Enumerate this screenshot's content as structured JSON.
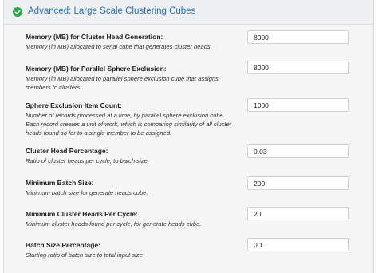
{
  "section": {
    "title": "Advanced: Large Scale Clustering Cubes",
    "status_icon": "check-circle-icon",
    "accent_color": "#2a6ebb",
    "status_color": "#28a745"
  },
  "fields": [
    {
      "label": "Memory (MB) for Cluster Head Generation:",
      "description": "Memory (in MB) allocated to serial cube that generates cluster heads.",
      "value": "8000"
    },
    {
      "label": "Memory (MB) for Parallel Sphere Exclusion:",
      "description": "Memory (in MB) allocated to parallel sphere exclusion cube that assigns members to clusters.",
      "value": "8000"
    },
    {
      "label": "Sphere Exclusion Item Count:",
      "description": "Number of records processed at a time, by parallel sphere exclusion cube. Each record creates a unit of work, which is comparing similarity of all cluster heads found so far to a single member to be assigned.",
      "value": "1000"
    },
    {
      "label": "Cluster Head Percentage:",
      "description": "Ratio of cluster heads per cycle, to batch size",
      "value": "0.03"
    },
    {
      "label": "Minimum Batch Size:",
      "description": "Minimum batch size for generate heads cube.",
      "value": "200"
    },
    {
      "label": "Minimum Cluster Heads Per Cycle:",
      "description": "Minimum cluster heads found per cycle, for generate heads cube.",
      "value": "20"
    },
    {
      "label": "Batch Size Percentage:",
      "description": "Starting ratio of batch size to total input size",
      "value": "0.1"
    }
  ]
}
